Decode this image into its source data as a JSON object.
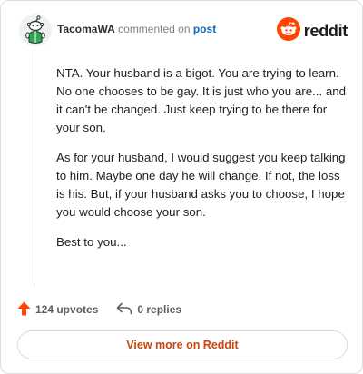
{
  "header": {
    "username": "TacomaWA",
    "action_text": "commented on",
    "post_link": "post",
    "brand": "reddit"
  },
  "comment": {
    "paragraphs": [
      "NTA. Your husband is a bigot. You are trying to learn. No one chooses to be gay. It is just who you are... and it can't be changed. Just keep trying to be there for your son.",
      "As for your husband, I would suggest you keep talking to him. Maybe one day he will change. If not, the loss is his. But, if your husband asks you to choose, I hope you would choose your son.",
      "Best to you..."
    ]
  },
  "actions": {
    "upvotes": "124 upvotes",
    "replies": "0 replies"
  },
  "footer": {
    "view_more": "View more on Reddit"
  },
  "colors": {
    "brand_orange": "#ff4500",
    "link_blue": "#0f69b4",
    "view_more_text": "#c8470f",
    "upvote_arrow": "#ff4500"
  },
  "icons": {
    "avatar": "snoo-avatar-icon",
    "logo": "reddit-snoo-icon",
    "upvote": "upvote-arrow-icon",
    "reply": "reply-arrow-icon"
  }
}
